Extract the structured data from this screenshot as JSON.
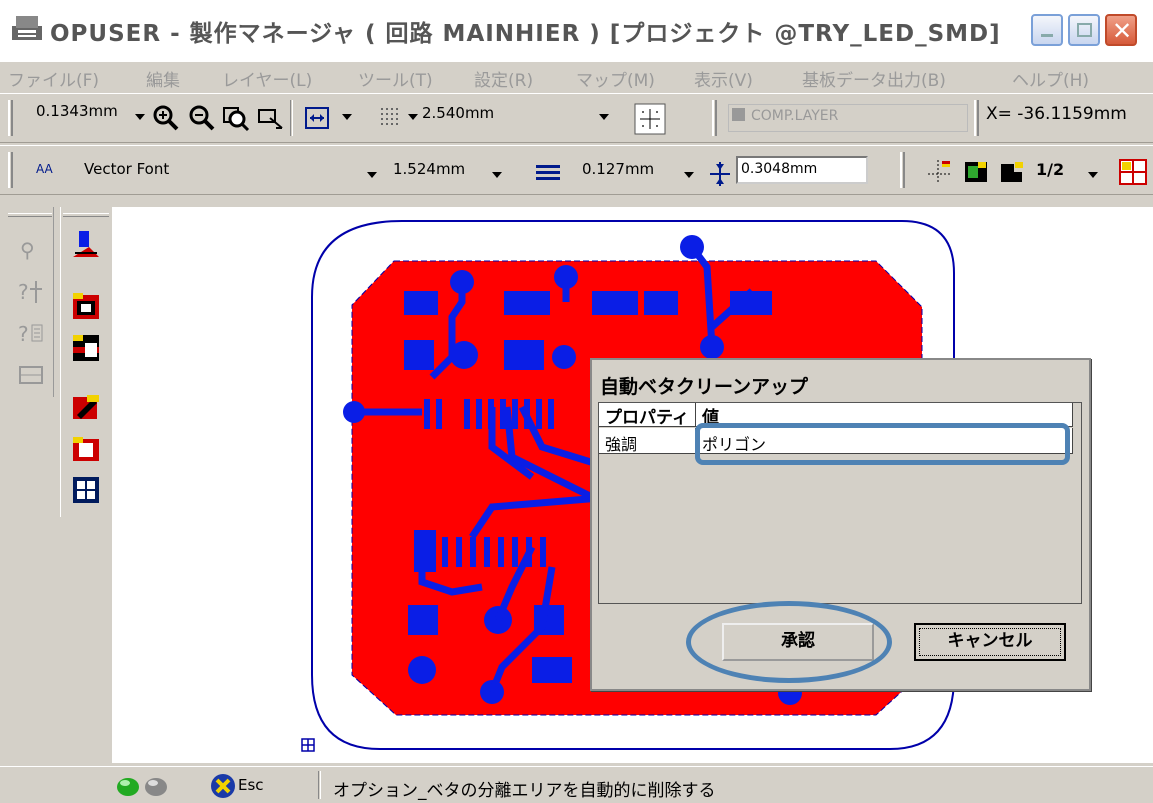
{
  "window": {
    "title": "OPUSER - 製作マネージャ ( 回路 MAINHIER ) [プロジェクト @TRY_LED_SMD]"
  },
  "menu": [
    "ファイル(F)",
    "編集",
    "レイヤー(L)",
    "ツール(T)",
    "設定(R)",
    "マップ(M)",
    "表示(V)",
    "基板データ出力(B)",
    "ヘルプ(H)"
  ],
  "toolbar1": {
    "zoom_value": "0.1343mm",
    "grid_value": "2.540mm",
    "layer_value": "COMP.LAYER",
    "coord_x": "X= -36.1159mm"
  },
  "toolbar2": {
    "font_prefix": "AA",
    "font_value": "Vector Font",
    "text_size": "1.524mm",
    "line_width": "0.127mm",
    "spacing": "0.3048mm",
    "fraction_label": "1/2"
  },
  "status": {
    "esc_label": "Esc",
    "message": "オプション_ベタの分離エリアを自動的に削除する"
  },
  "dialog": {
    "title": "自動ベタクリーンアップ",
    "col_property": "プロパティ",
    "col_value": "値",
    "row_property": "強調",
    "row_value": "ポリゴン",
    "ok_label": "承認",
    "cancel_label": "キャンセル"
  },
  "colors": {
    "copper": "#ff0000",
    "pad": "#0a1ee6",
    "outline": "#0000aa",
    "highlight": "#4e82b4"
  }
}
